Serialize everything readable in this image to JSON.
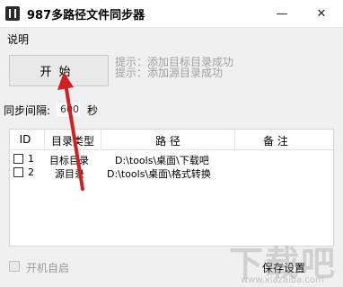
{
  "window": {
    "title": "987多路径文件同步器",
    "minimize_glyph": "—",
    "close_glyph": "✕"
  },
  "menu": {
    "items": [
      {
        "label": "说明"
      }
    ]
  },
  "controls": {
    "start_label": "开始",
    "hints": [
      "提示：添加目标目录成功",
      "提示：添加源目录成功"
    ],
    "interval_label": "同步间隔:",
    "interval_value": "600",
    "interval_unit": "秒"
  },
  "table": {
    "columns": [
      "ID",
      "目录类型",
      "路 径",
      "备 注"
    ],
    "rows": [
      {
        "id": "1",
        "type": "目标目录",
        "path": "D:\\tools\\桌面\\下载吧",
        "note": "",
        "checked": false
      },
      {
        "id": "2",
        "type": "源目录",
        "path": "D:\\tools\\桌面\\格式转换",
        "note": "",
        "checked": false
      }
    ]
  },
  "footer": {
    "autostart_label": "开机自启",
    "save_label": "保存设置"
  },
  "watermark": {
    "text": "下载吧",
    "url": "www.xiazaiba.com"
  },
  "colors": {
    "arrow": "#d22020",
    "hint_text": "#a0a0a0",
    "window_bg": "#f0f0f0"
  }
}
